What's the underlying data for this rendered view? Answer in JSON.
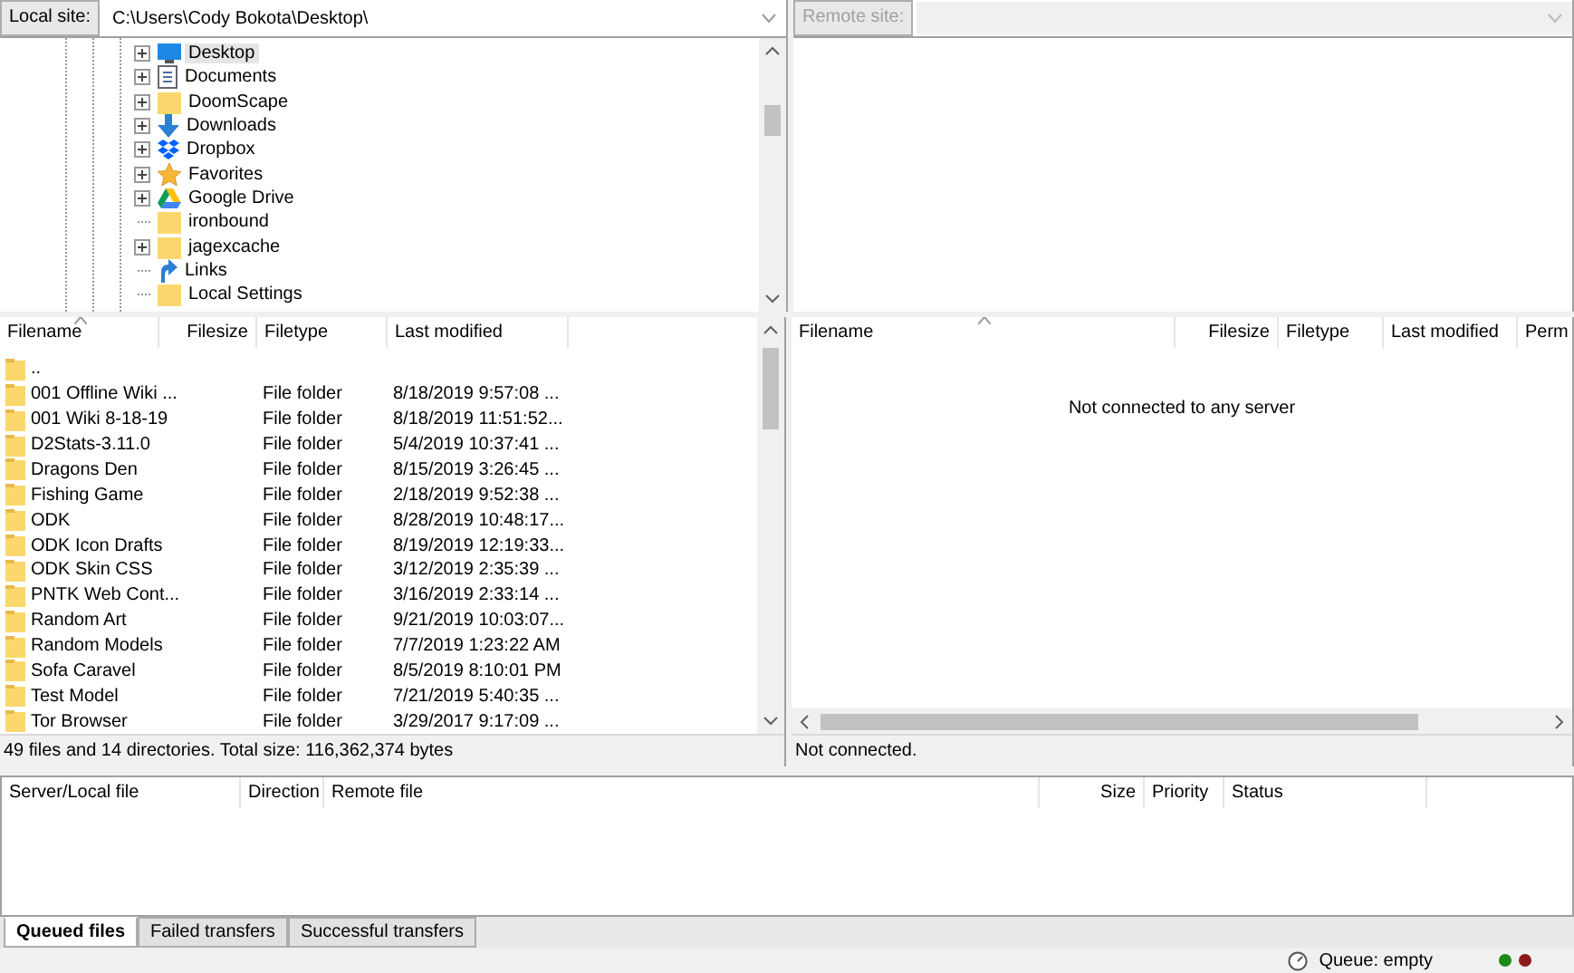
{
  "local_site": {
    "label": "Local site:",
    "path": "C:\\Users\\Cody Bokota\\Desktop\\"
  },
  "remote_site": {
    "label": "Remote site:",
    "disabled": true
  },
  "local_tree": [
    {
      "name": "Desktop",
      "kind": "desktop",
      "expandable": true,
      "selected": true
    },
    {
      "name": "Documents",
      "kind": "documents",
      "expandable": true,
      "selected": false
    },
    {
      "name": "DoomScape",
      "kind": "folder",
      "expandable": true,
      "selected": false
    },
    {
      "name": "Downloads",
      "kind": "downloads",
      "expandable": true,
      "selected": false
    },
    {
      "name": "Dropbox",
      "kind": "dropbox",
      "expandable": true,
      "selected": false
    },
    {
      "name": "Favorites",
      "kind": "favorites",
      "expandable": true,
      "selected": false
    },
    {
      "name": "Google Drive",
      "kind": "drive",
      "expandable": true,
      "selected": false
    },
    {
      "name": "ironbound",
      "kind": "folder",
      "expandable": false,
      "selected": false
    },
    {
      "name": "jagexcache",
      "kind": "folder",
      "expandable": true,
      "selected": false
    },
    {
      "name": "Links",
      "kind": "links",
      "expandable": false,
      "selected": false
    },
    {
      "name": "Local Settings",
      "kind": "folder",
      "expandable": false,
      "selected": false
    }
  ],
  "local_files": {
    "columns": [
      {
        "label": "Filename",
        "sorted": true
      },
      {
        "label": "Filesize",
        "sorted": false
      },
      {
        "label": "Filetype",
        "sorted": false
      },
      {
        "label": "Last modified",
        "sorted": false
      }
    ],
    "rows": [
      {
        "name": ".."
      },
      {
        "name": "001 Offline Wiki ...",
        "type": "File folder",
        "modified": "8/18/2019 9:57:08 ..."
      },
      {
        "name": "001 Wiki 8-18-19",
        "type": "File folder",
        "modified": "8/18/2019 11:51:52..."
      },
      {
        "name": "D2Stats-3.11.0",
        "type": "File folder",
        "modified": "5/4/2019 10:37:41 ..."
      },
      {
        "name": "Dragons Den",
        "type": "File folder",
        "modified": "8/15/2019 3:26:45 ..."
      },
      {
        "name": "Fishing Game",
        "type": "File folder",
        "modified": "2/18/2019 9:52:38 ..."
      },
      {
        "name": "ODK",
        "type": "File folder",
        "modified": "8/28/2019 10:48:17..."
      },
      {
        "name": "ODK Icon Drafts",
        "type": "File folder",
        "modified": "8/19/2019 12:19:33..."
      },
      {
        "name": "ODK Skin CSS",
        "type": "File folder",
        "modified": "3/12/2019 2:35:39 ..."
      },
      {
        "name": "PNTK Web Cont...",
        "type": "File folder",
        "modified": "3/16/2019 2:33:14 ..."
      },
      {
        "name": "Random Art",
        "type": "File folder",
        "modified": "9/21/2019 10:03:07..."
      },
      {
        "name": "Random Models",
        "type": "File folder",
        "modified": "7/7/2019 1:23:22 AM"
      },
      {
        "name": "Sofa Caravel",
        "type": "File folder",
        "modified": "8/5/2019 8:10:01 PM"
      },
      {
        "name": "Test Model",
        "type": "File folder",
        "modified": "7/21/2019 5:40:35 ..."
      },
      {
        "name": "Tor Browser",
        "type": "File folder",
        "modified": "3/29/2017 9:17:09 ..."
      }
    ]
  },
  "local_status": "49 files and 14 directories. Total size: 116,362,374 bytes",
  "remote_files": {
    "columns": [
      {
        "label": "Filename",
        "sorted": true
      },
      {
        "label": "Filesize",
        "sorted": false
      },
      {
        "label": "Filetype",
        "sorted": false
      },
      {
        "label": "Last modified",
        "sorted": false
      },
      {
        "label": "Perm",
        "sorted": false
      }
    ],
    "message": "Not connected to any server"
  },
  "remote_status": "Not connected.",
  "queue": {
    "columns": [
      {
        "label": "Server/Local file"
      },
      {
        "label": "Direction"
      },
      {
        "label": "Remote file"
      },
      {
        "label": "Size"
      },
      {
        "label": "Priority"
      },
      {
        "label": "Status"
      }
    ]
  },
  "queue_tabs": [
    {
      "label": "Queued files",
      "selected": true
    },
    {
      "label": "Failed transfers",
      "selected": false
    },
    {
      "label": "Successful transfers",
      "selected": false
    }
  ],
  "status_bar": {
    "queue": "Queue: empty"
  }
}
